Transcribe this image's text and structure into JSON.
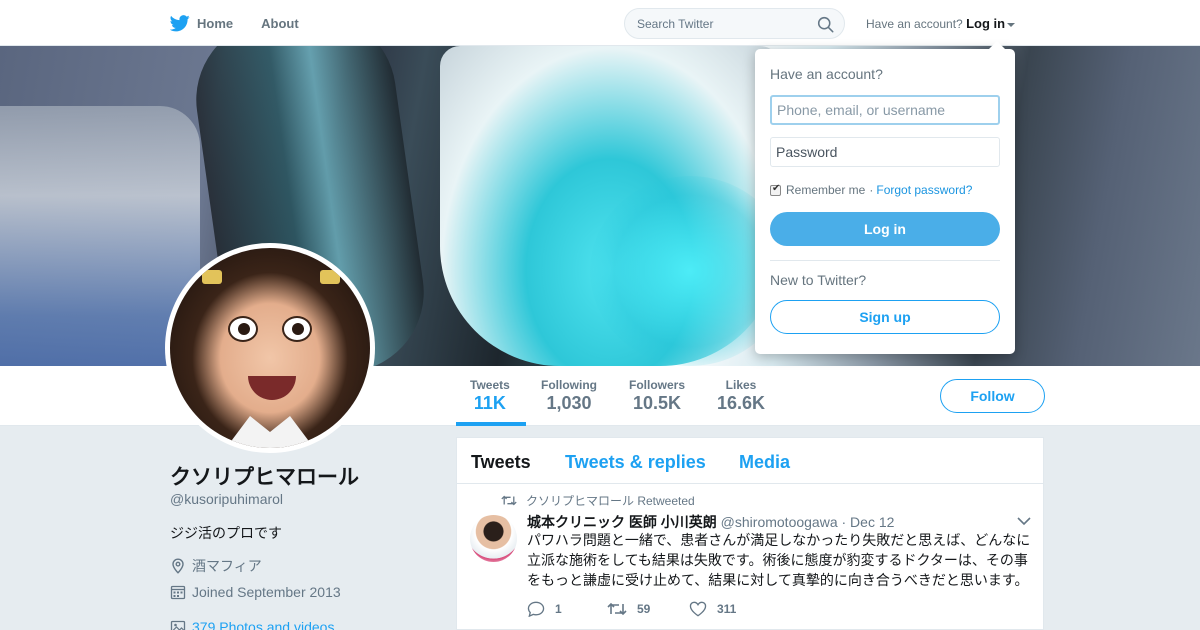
{
  "nav": {
    "home_label": "Home",
    "about_label": "About",
    "search_placeholder": "Search Twitter",
    "have_account_label": "Have an account?",
    "login_label": "Log in"
  },
  "profile": {
    "name": "クソリプヒマロール",
    "handle": "@kusoripuhimarol",
    "bio": "ジジ活のプロです",
    "location": "酒マフィア",
    "joined": "Joined September 2013",
    "photos_link": "379 Photos and videos"
  },
  "stats": [
    {
      "label": "Tweets",
      "value": "11K",
      "active": true
    },
    {
      "label": "Following",
      "value": "1,030",
      "active": false
    },
    {
      "label": "Followers",
      "value": "10.5K",
      "active": false
    },
    {
      "label": "Likes",
      "value": "16.6K",
      "active": false
    }
  ],
  "follow_label": "Follow",
  "tabs": [
    {
      "label": "Tweets",
      "active": true
    },
    {
      "label": "Tweets & replies",
      "active": false
    },
    {
      "label": "Media",
      "active": false
    }
  ],
  "tweet": {
    "retweeted_by": "クソリプヒマロール Retweeted",
    "name": "城本クリニック 医師 小川英朗",
    "handle": "@shiromotoogawa",
    "date": "· Dec 12",
    "text": "パワハラ問題と一緒で、患者さんが満足しなかったり失敗だと思えば、どんなに立派な施術をしても結果は失敗です。術後に態度が豹変するドクターは、その事をもっと謙虚に受け止めて、結果に対して真摯的に向き合うべきだと思います。",
    "replies": "1",
    "retweets": "59",
    "likes": "311"
  },
  "login_dropdown": {
    "title": "Have an account?",
    "username_placeholder": "Phone, email, or username",
    "password_placeholder": "Password",
    "remember_label": "Remember me",
    "separator": "·",
    "forgot_label": "Forgot password?",
    "login_button": "Log in",
    "new_label": "New to Twitter?",
    "signup_button": "Sign up"
  },
  "colors": {
    "accent": "#1da1f2",
    "background": "#e6ecf0",
    "muted_text": "#657786"
  }
}
